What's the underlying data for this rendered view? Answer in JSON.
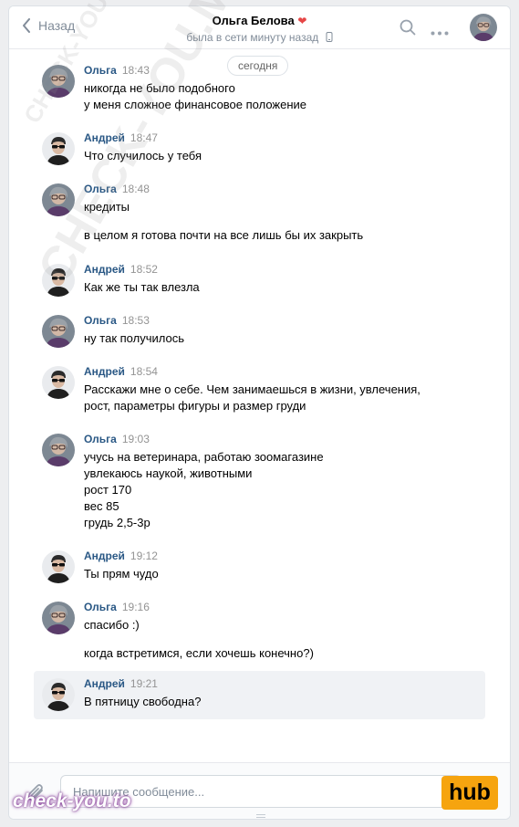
{
  "header": {
    "back_label": "Назад",
    "title": "Ольга Белова",
    "title_heart": "❤",
    "status": "была в сети минуту назад"
  },
  "date_divider": "сегодня",
  "messages": [
    {
      "author": "Ольга",
      "time": "18:43",
      "lines": [
        "никогда не было подобного",
        "у меня сложное финансовое положение"
      ]
    },
    {
      "author": "Андрей",
      "time": "18:47",
      "lines": [
        "Что случилось у тебя"
      ]
    },
    {
      "author": "Ольга",
      "time": "18:48",
      "lines": [
        "кредиты",
        "",
        "в целом я готова почти на все лишь бы их закрыть"
      ]
    },
    {
      "author": "Андрей",
      "time": "18:52",
      "lines": [
        "Как же ты так влезла"
      ]
    },
    {
      "author": "Ольга",
      "time": "18:53",
      "lines": [
        "ну так получилось"
      ]
    },
    {
      "author": "Андрей",
      "time": "18:54",
      "lines": [
        "Расскажи мне о себе. Чем занимаешься в жизни, увлечения,",
        "рост, параметры фигуры и размер груди"
      ]
    },
    {
      "author": "Ольга",
      "time": "19:03",
      "lines": [
        "учусь на ветеринара, работаю зоомагазине",
        "увлекаюсь наукой, животными",
        "рост 170",
        "вес 85",
        "грудь 2,5-3р"
      ]
    },
    {
      "author": "Андрей",
      "time": "19:12",
      "lines": [
        "Ты прям чудо"
      ]
    },
    {
      "author": "Ольга",
      "time": "19:16",
      "lines": [
        "спасибо :)",
        "",
        "когда встретимся, если хочешь конечно?)"
      ]
    },
    {
      "author": "Андрей",
      "time": "19:21",
      "lines": [
        "В пятницу свободна?"
      ]
    }
  ],
  "composer": {
    "placeholder": "Напишите сообщение..."
  },
  "watermarks": {
    "small": "CHECK-YOU.ME",
    "large": "CHECK-YOU.ME",
    "bottom_left": "check-you.to",
    "bottom_right": "hub"
  },
  "colors": {
    "author": "#2a5885",
    "accent": "#5181b8",
    "hub_bg": "#f6a40f"
  }
}
